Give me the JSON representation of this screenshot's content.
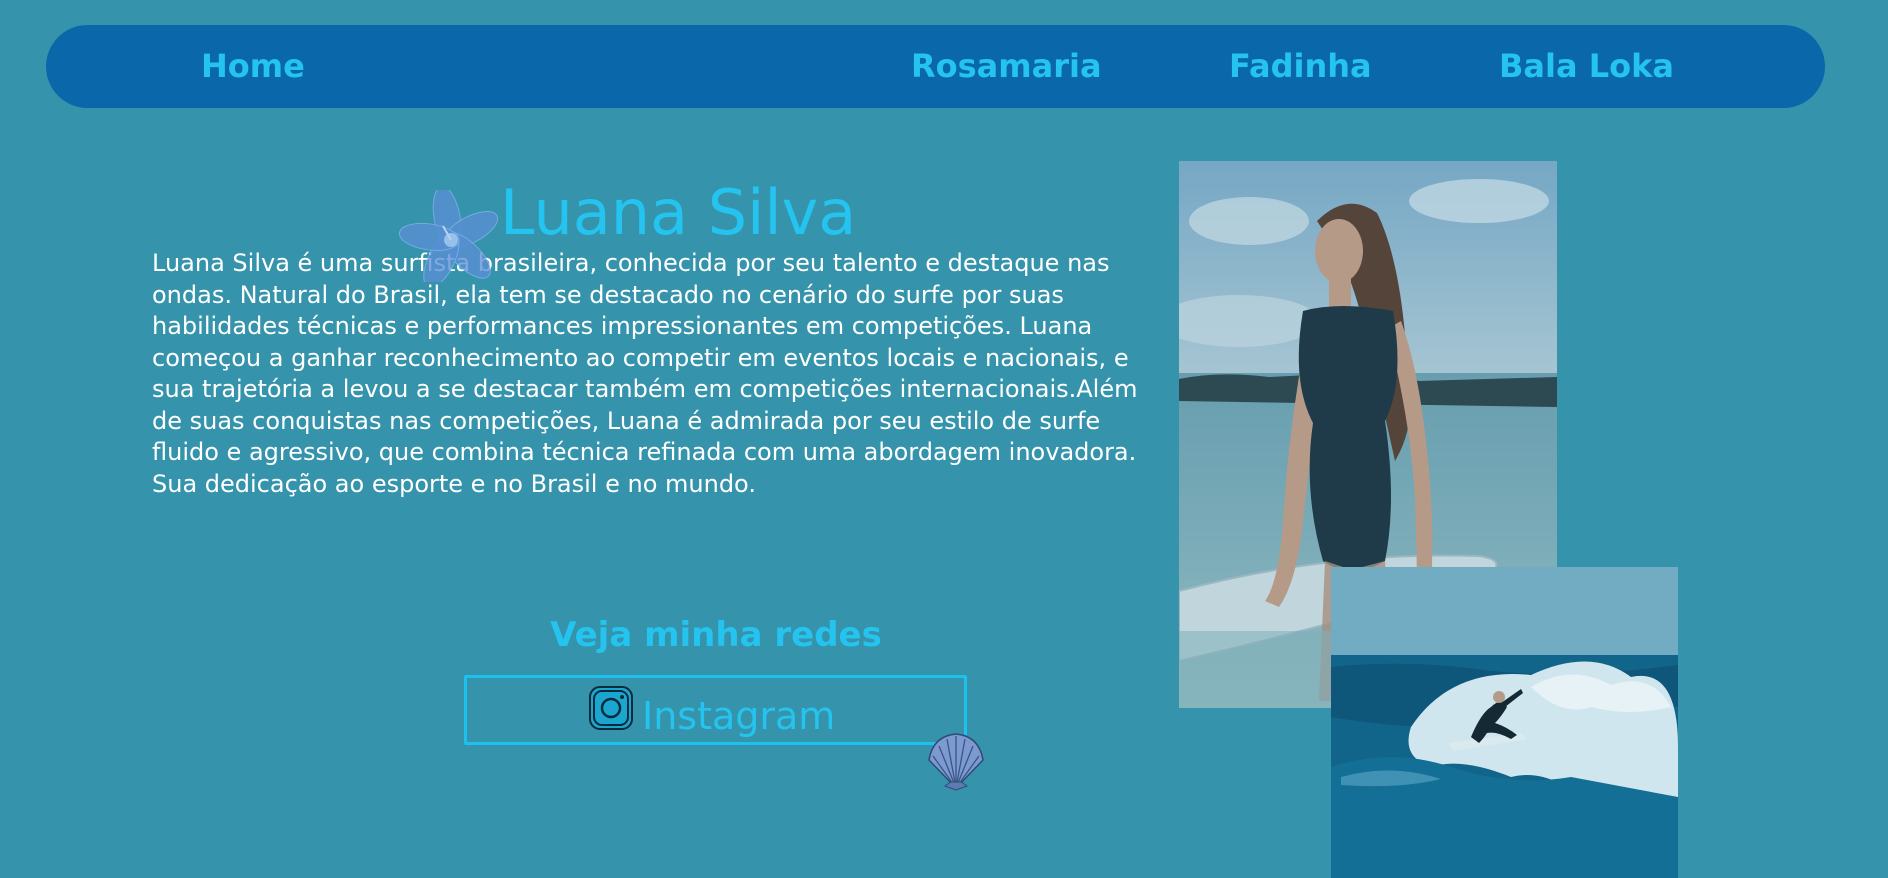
{
  "nav": {
    "home": "Home",
    "links": [
      "Rosamaria",
      "Fadinha",
      "Bala Loka"
    ]
  },
  "profile": {
    "name": "Luana Silva",
    "bio": "Luana Silva é uma surfista brasileira, conhecida por seu talento e destaque nas ondas. Natural do Brasil, ela tem se destacado no cenário do surfe por suas habilidades técnicas e performances impressionantes em competições. Luana começou a ganhar reconhecimento ao competir em eventos locais e nacionais, e sua trajetória a levou a se destacar também em competições internacionais.Além de suas conquistas nas competições, Luana é admirada por seu estilo de surfe fluido e agressivo, que combina técnica refinada com uma abordagem inovadora. Sua dedicação ao esporte e no Brasil e no mundo."
  },
  "social": {
    "heading": "Veja minha redes",
    "instagram_label": "Instagram"
  },
  "icons": {
    "flower": "hibiscus-flower-icon",
    "instagram": "instagram-icon",
    "shell": "seashell-icon"
  },
  "colors": {
    "background": "#3594ab",
    "navbar": "#0a67aa",
    "accent": "#25c3ef",
    "body_text": "#ffffff"
  }
}
